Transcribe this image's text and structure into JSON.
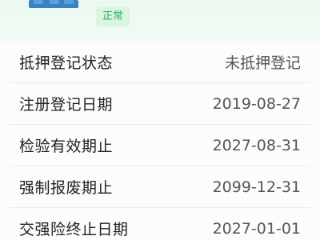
{
  "header": {
    "status_badge": "正常",
    "accent_color": "#2bb062",
    "logo_icon": "vehicle-plate-icon"
  },
  "rows": [
    {
      "label": "抵押登记状态",
      "value": "未抵押登记"
    },
    {
      "label": "注册登记日期",
      "value": "2019-08-27"
    },
    {
      "label": "检验有效期止",
      "value": "2027-08-31"
    },
    {
      "label": "强制报废期止",
      "value": "2099-12-31"
    },
    {
      "label": "交强险终止日期",
      "value": "2027-01-01"
    }
  ]
}
